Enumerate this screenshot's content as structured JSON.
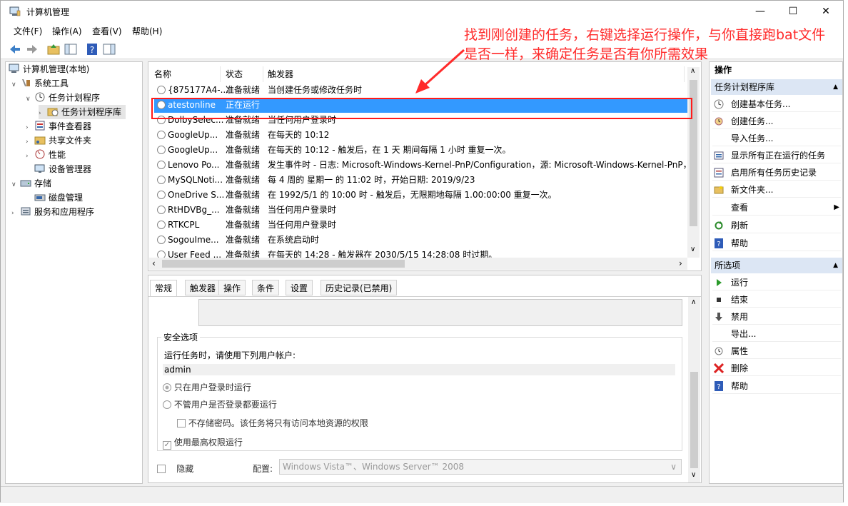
{
  "window": {
    "title": "计算机管理"
  },
  "menubar": {
    "file": "文件(F)",
    "action": "操作(A)",
    "view": "查看(V)",
    "help": "帮助(H)"
  },
  "tree": {
    "root": "计算机管理(本地)",
    "system_tools": "系统工具",
    "task_scheduler": "任务计划程序",
    "task_library": "任务计划程序库",
    "event_viewer": "事件查看器",
    "shared_folders": "共享文件夹",
    "performance": "性能",
    "device_manager": "设备管理器",
    "storage": "存储",
    "disk_management": "磁盘管理",
    "services_apps": "服务和应用程序"
  },
  "list": {
    "columns": [
      "名称",
      "状态",
      "触发器"
    ],
    "rows": [
      {
        "name": "{875177A4-...",
        "status": "准备就绪",
        "trigger": "当创建任务或修改任务时"
      },
      {
        "name": "atestonline",
        "status": "正在运行",
        "trigger": ""
      },
      {
        "name": "DolbySelec...",
        "status": "准备就绪",
        "trigger": "当任何用户登录时"
      },
      {
        "name": "GoogleUp...",
        "status": "准备就绪",
        "trigger": "在每天的 10:12"
      },
      {
        "name": "GoogleUp...",
        "status": "准备就绪",
        "trigger": "在每天的 10:12 - 触发后，在 1 天 期间每隔 1 小时 重复一次。"
      },
      {
        "name": "Lenovo Po...",
        "status": "准备就绪",
        "trigger": "发生事件时 - 日志: Microsoft-Windows-Kernel-PnP/Configuration，源: Microsoft-Windows-Kernel-PnP，"
      },
      {
        "name": "MySQLNoti...",
        "status": "准备就绪",
        "trigger": "每 4 周的 星期一 的 11:02 时，开始日期: 2019/9/23"
      },
      {
        "name": "OneDrive S...",
        "status": "准备就绪",
        "trigger": "在 1992/5/1 的 10:00 时 - 触发后，无限期地每隔 1.00:00:00 重复一次。"
      },
      {
        "name": "RtHDVBg_...",
        "status": "准备就绪",
        "trigger": "当任何用户登录时"
      },
      {
        "name": "RTKCPL",
        "status": "准备就绪",
        "trigger": "当任何用户登录时"
      },
      {
        "name": "SogouIme...",
        "status": "准备就绪",
        "trigger": "在系统启动时"
      },
      {
        "name": "User Feed ...",
        "status": "准备就绪",
        "trigger": "在每天的 14:28 - 触发器在 2030/5/15 14:28:08 时过期。"
      }
    ]
  },
  "tabs": [
    "常规",
    "触发器",
    "操作",
    "条件",
    "设置",
    "历史记录(已禁用)"
  ],
  "general": {
    "security_title": "安全选项",
    "run_as_label": "运行任务时，请使用下列用户帐户:",
    "user": "admin",
    "opt_logged_on": "只在用户登录时运行",
    "opt_whether": "不管用户是否登录都要运行",
    "no_store_pwd": "不存储密码。该任务将只有访问本地资源的权限",
    "highest": "使用最高权限运行",
    "hidden": "隐藏",
    "config_label": "配置:",
    "config_value": "Windows Vista™、Windows Server™ 2008"
  },
  "actions": {
    "header": "操作",
    "sec1": "任务计划程序库",
    "items1": [
      "创建基本任务...",
      "创建任务...",
      "导入任务...",
      "显示所有正在运行的任务",
      "启用所有任务历史记录",
      "新文件夹...",
      "查看",
      "刷新",
      "帮助"
    ],
    "sec2": "所选项",
    "items2": [
      "运行",
      "结束",
      "禁用",
      "导出...",
      "属性",
      "删除",
      "帮助"
    ]
  },
  "annotation": "找到刚创建的任务，右键选择运行操作，与你直接跑bat文件是否一样，来确定任务是否有你所需效果",
  "colors": {
    "selection": "#3399ff",
    "annotation": "#ff2b2b",
    "section": "#dce6f4"
  }
}
